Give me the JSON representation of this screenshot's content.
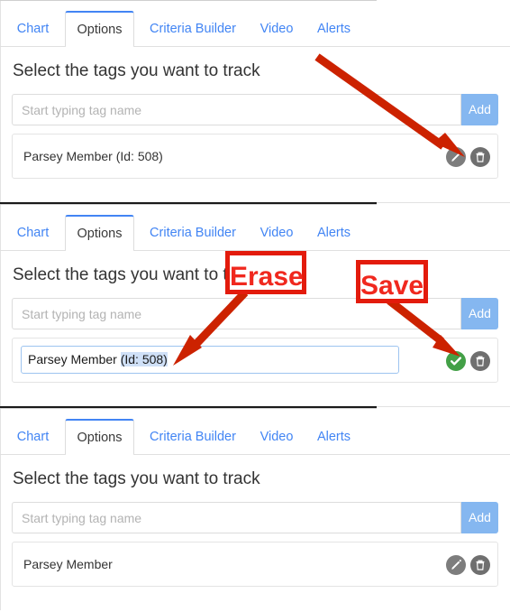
{
  "app": {
    "accent_blue": "#4285f4",
    "add_button_bg": "#85b7f0",
    "annotation_red": "#e31b0c",
    "save_green": "#43a047",
    "icon_gray": "#7d7d7d"
  },
  "tabs": [
    {
      "label": "Chart",
      "active": false
    },
    {
      "label": "Options",
      "active": true
    },
    {
      "label": "Criteria Builder",
      "active": false
    },
    {
      "label": "Video",
      "active": false
    },
    {
      "label": "Alerts",
      "active": false
    }
  ],
  "heading": "Select the tags you want to track",
  "search": {
    "placeholder": "Start typing tag name",
    "value": "",
    "add_label": "Add"
  },
  "panels": [
    {
      "state": "view",
      "tag_label": "Parsey Member (Id: 508)",
      "actions": [
        "edit-icon",
        "trash-icon"
      ]
    },
    {
      "state": "edit",
      "tag_text_plain": "Parsey Member ",
      "tag_text_selected": "(Id: 508)",
      "tag_full": "Parsey Member (Id: 508)",
      "actions": [
        "check-icon",
        "trash-icon"
      ]
    },
    {
      "state": "view",
      "tag_label": "Parsey Member",
      "actions": [
        "edit-icon",
        "trash-icon"
      ]
    }
  ],
  "annotations": [
    {
      "name": "arrow-to-edit-button",
      "kind": "arrow"
    },
    {
      "name": "erase-callout",
      "label": "Erase"
    },
    {
      "name": "save-callout",
      "label": "Save"
    }
  ]
}
